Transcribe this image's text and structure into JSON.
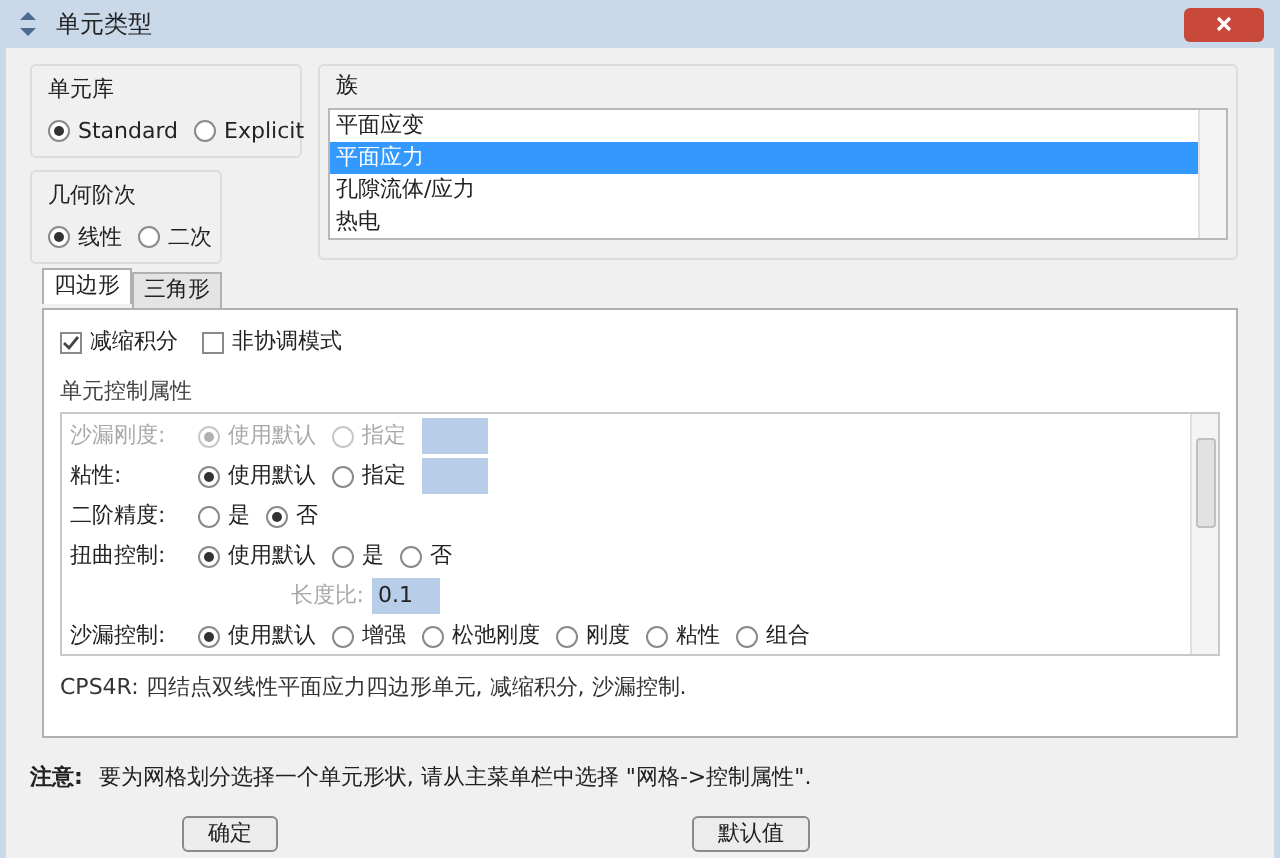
{
  "window": {
    "title": "单元类型"
  },
  "element_library": {
    "label": "单元库",
    "options": [
      {
        "label": "Standard",
        "selected": true
      },
      {
        "label": "Explicit",
        "selected": false
      }
    ]
  },
  "geometric_order": {
    "label": "几何阶次",
    "options": [
      {
        "label": "线性",
        "selected": true
      },
      {
        "label": "二次",
        "selected": false
      }
    ]
  },
  "family": {
    "label": "族",
    "items": [
      {
        "label": "平面应变",
        "selected": false
      },
      {
        "label": "平面应力",
        "selected": true
      },
      {
        "label": "孔隙流体/应力",
        "selected": false
      },
      {
        "label": "热电",
        "selected": false
      }
    ]
  },
  "tabs": [
    {
      "label": "四边形",
      "selected": true
    },
    {
      "label": "三角形",
      "selected": false
    }
  ],
  "checkboxes": [
    {
      "label": "减缩积分",
      "checked": true
    },
    {
      "label": "非协调模式",
      "checked": false
    }
  ],
  "controls": {
    "label": "单元控制属性",
    "rows": [
      {
        "kind": "radio_input",
        "label": "沙漏刚度:",
        "disabled": true,
        "options": [
          {
            "label": "使用默认",
            "selected": true
          },
          {
            "label": "指定",
            "selected": false
          }
        ]
      },
      {
        "kind": "radio_input",
        "label": "粘性:",
        "disabled": false,
        "options": [
          {
            "label": "使用默认",
            "selected": true
          },
          {
            "label": "指定",
            "selected": false
          }
        ]
      },
      {
        "kind": "radio",
        "label": "二阶精度:",
        "disabled": false,
        "options": [
          {
            "label": "是",
            "selected": false
          },
          {
            "label": "否",
            "selected": true
          }
        ]
      },
      {
        "kind": "radio",
        "label": "扭曲控制:",
        "disabled": false,
        "options": [
          {
            "label": "使用默认",
            "selected": true
          },
          {
            "label": "是",
            "selected": false
          },
          {
            "label": "否",
            "selected": false
          }
        ]
      },
      {
        "kind": "value",
        "label": "长度比:",
        "disabled": true,
        "value": "0.1"
      },
      {
        "kind": "radio",
        "label": "沙漏控制:",
        "disabled": false,
        "options": [
          {
            "label": "使用默认",
            "selected": true
          },
          {
            "label": "增强",
            "selected": false
          },
          {
            "label": "松弛刚度",
            "selected": false
          },
          {
            "label": "刚度",
            "selected": false
          },
          {
            "label": "粘性",
            "selected": false
          },
          {
            "label": "组合",
            "selected": false
          }
        ]
      }
    ]
  },
  "description": "CPS4R: 四结点双线性平面应力四边形单元, 减缩积分, 沙漏控制.",
  "note": {
    "label": "注意:",
    "text": "要为网格划分选择一个单元形状, 请从主菜单栏中选择 \"网格->控制属性\"."
  },
  "buttons": [
    "确定",
    "默认值"
  ]
}
